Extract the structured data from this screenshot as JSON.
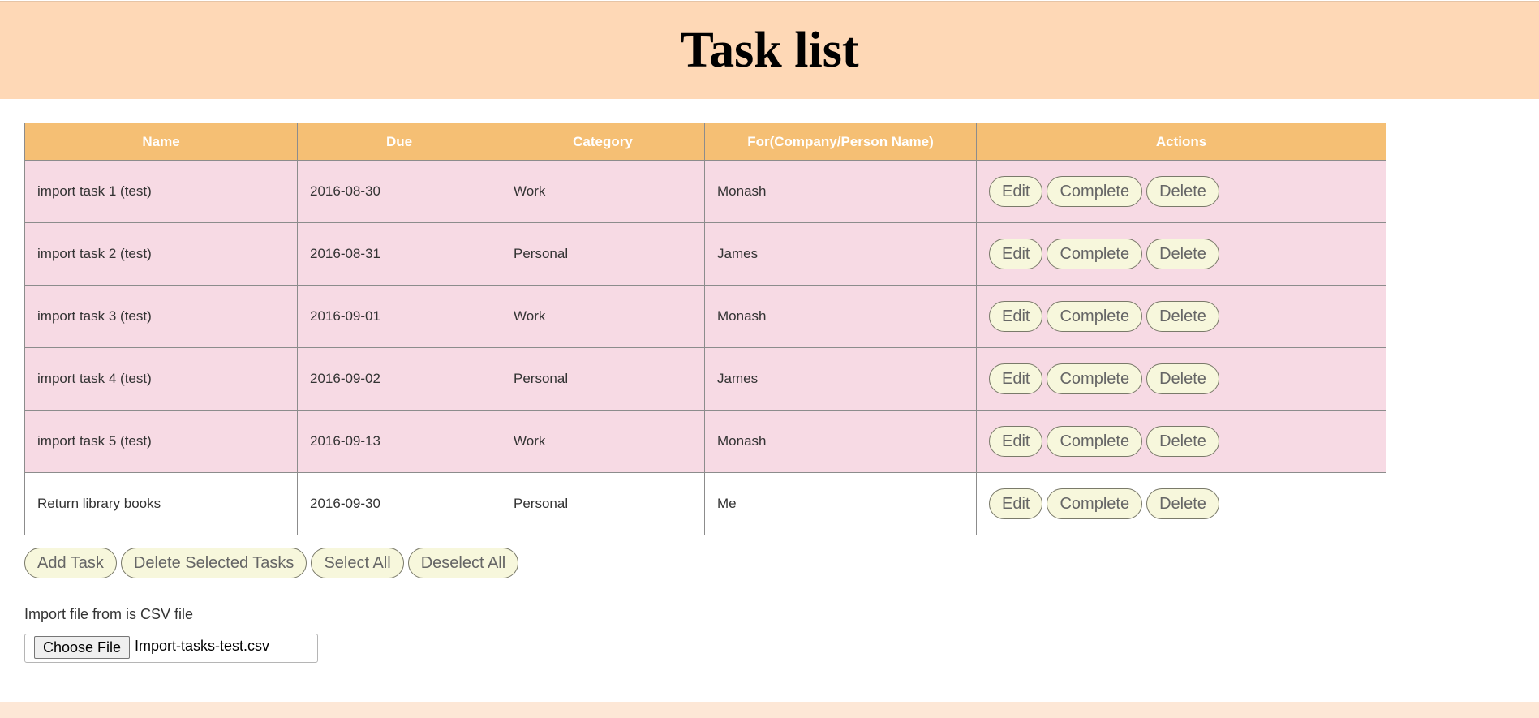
{
  "header": {
    "title": "Task list"
  },
  "table": {
    "columns": [
      "Name",
      "Due",
      "Category",
      "For(Company/Person Name)",
      "Actions"
    ],
    "rows": [
      {
        "name": "import task 1 (test)",
        "due": "2016-08-30",
        "category": "Work",
        "for": "Monash",
        "highlighted": true
      },
      {
        "name": "import task 2 (test)",
        "due": "2016-08-31",
        "category": "Personal",
        "for": "James",
        "highlighted": true
      },
      {
        "name": "import task 3 (test)",
        "due": "2016-09-01",
        "category": "Work",
        "for": "Monash",
        "highlighted": true
      },
      {
        "name": "import task 4 (test)",
        "due": "2016-09-02",
        "category": "Personal",
        "for": "James",
        "highlighted": true
      },
      {
        "name": "import task 5 (test)",
        "due": "2016-09-13",
        "category": "Work",
        "for": "Monash",
        "highlighted": true
      },
      {
        "name": "Return library books",
        "due": "2016-09-30",
        "category": "Personal",
        "for": "Me",
        "highlighted": false
      }
    ],
    "row_actions": {
      "edit": "Edit",
      "complete": "Complete",
      "delete": "Delete"
    }
  },
  "toolbar": {
    "add_task": "Add Task",
    "delete_selected": "Delete Selected Tasks",
    "select_all": "Select All",
    "deselect_all": "Deselect All"
  },
  "import": {
    "label": "Import file from is CSV file",
    "choose_file": "Choose File",
    "file_name": "Import-tasks-test.csv"
  },
  "colors": {
    "header_bg": "#fed8b6",
    "table_header_bg": "#f5bf74",
    "selected_row_bg": "#f7dae4",
    "button_bg": "#f7f7dc",
    "footer_bg": "#fde7d6"
  }
}
